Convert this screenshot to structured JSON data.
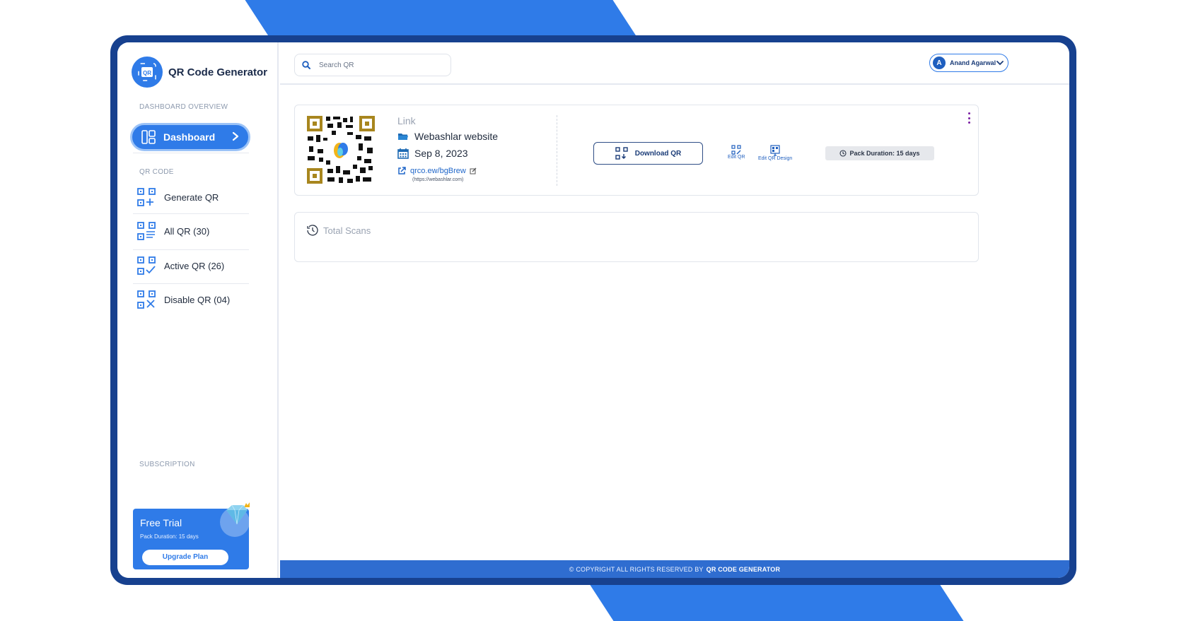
{
  "brand": {
    "name": "QR Code Generator",
    "logo_text": "QR"
  },
  "sidebar": {
    "dashboard_overview_label": "DASHBOARD OVERVIEW",
    "dashboard_button": "Dashboard",
    "qr_code_label": "QR CODE",
    "items": [
      {
        "label": "Generate QR",
        "icon": "qr-add-icon"
      },
      {
        "label": "All QR (30)",
        "icon": "qr-list-icon"
      },
      {
        "label": "Active QR (26)",
        "icon": "qr-check-icon"
      },
      {
        "label": "Disable QR (04)",
        "icon": "qr-disable-icon"
      }
    ],
    "subscription_label": "SUBSCRIPTION",
    "subscription": {
      "plan": "Free Trial",
      "duration": "Pack Duration: 15 days",
      "upgrade_label": "Upgrade Plan"
    }
  },
  "topbar": {
    "search_placeholder": "Search QR",
    "user_initial": "A",
    "user_name": "Anand Agarwal"
  },
  "qr_card": {
    "type": "Link",
    "name": "Webashlar website",
    "date": "Sep 8, 2023",
    "short_url": "qrco.ew/bgBrew",
    "original_url": "(https://webashlar.com)",
    "download_label": "Download QR",
    "edit_qr_label": "Edit QR",
    "edit_design_label": "Edit QR Design",
    "pack_duration": "Pack Duration: 15 days"
  },
  "scans_card": {
    "title": "Total Scans"
  },
  "footer": {
    "text": "© COPYRIGHT ALL RIGHTS RESERVED BY",
    "brand": "QR CODE GENERATOR"
  },
  "colors": {
    "accent": "#2f7be8",
    "frame": "#17418f",
    "footer": "#2f6dd0",
    "qr_finder": "#a8861e"
  }
}
